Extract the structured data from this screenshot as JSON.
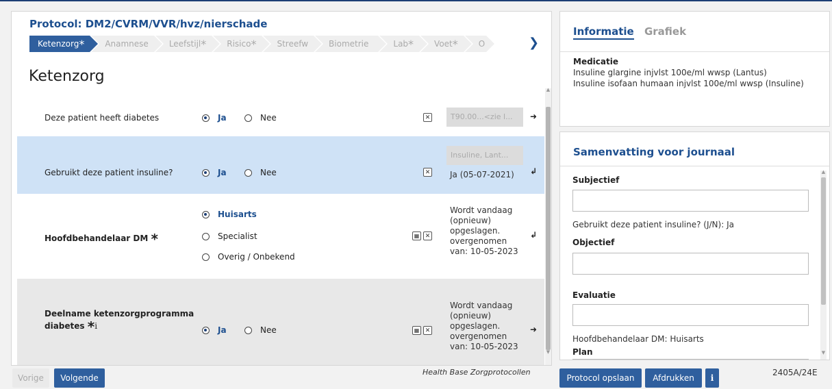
{
  "protocol_title": "Protocol: DM2/CVRM/VVR/hvz/nierschade",
  "breadcrumbs": [
    {
      "label": "Ketenzorg",
      "star": true,
      "active": true
    },
    {
      "label": "Anamnese",
      "star": false,
      "active": false
    },
    {
      "label": "Leefstijl",
      "star": true,
      "active": false
    },
    {
      "label": "Risico",
      "star": true,
      "active": false
    },
    {
      "label": "Streefw",
      "star": false,
      "active": false
    },
    {
      "label": "Biometrie",
      "star": false,
      "active": false
    },
    {
      "label": "Lab",
      "star": true,
      "active": false
    },
    {
      "label": "Voet",
      "star": true,
      "active": false
    },
    {
      "label": "O",
      "star": false,
      "active": false
    }
  ],
  "section_title": "Ketenzorg",
  "rows": [
    {
      "question": "Deze patient heeft diabetes",
      "options": [
        {
          "label": "Ja",
          "selected": true
        },
        {
          "label": "Nee",
          "selected": false
        }
      ],
      "code_placeholder": "T90.00...<zie l...",
      "note": ""
    },
    {
      "question": "Gebruikt deze patient insuline?",
      "options": [
        {
          "label": "Ja",
          "selected": true
        },
        {
          "label": "Nee",
          "selected": false
        }
      ],
      "code_placeholder": "Insuline, Lant...",
      "note": "Ja (05-07-2021)"
    },
    {
      "question": "Hoofdbehandelaar DM",
      "required": "*",
      "options": [
        {
          "label": "Huisarts",
          "selected": true
        },
        {
          "label": "Specialist",
          "selected": false
        },
        {
          "label": "Overig / Onbekend",
          "selected": false
        }
      ],
      "note_lines": [
        "Wordt vandaag",
        "(opnieuw)",
        "opgeslagen.",
        "overgenomen",
        "van: 10-05-2023"
      ]
    },
    {
      "question_line1": "Deelname ketenzorgprogramma",
      "question_line2": "diabetes",
      "required": "*",
      "info": "i",
      "options": [
        {
          "label": "Ja",
          "selected": true
        },
        {
          "label": "Nee",
          "selected": false
        }
      ],
      "note_lines": [
        "Wordt vandaag",
        "(opnieuw)",
        "opgeslagen.",
        "overgenomen",
        "van: 10-05-2023"
      ]
    }
  ],
  "nav": {
    "prev": "Vorige",
    "next": "Volgende"
  },
  "footer_brand": "Health Base Zorgprotocollen",
  "info_panel": {
    "tab_active": "Informatie",
    "tab_other": "Grafiek",
    "medication_heading": "Medicatie",
    "medication": [
      "Insuline glargine injvlst 100e/ml wwsp (Lantus)",
      "Insuline isofaan humaan injvlst 100e/ml wwsp (Insuline)"
    ]
  },
  "summary": {
    "title": "Samenvatting voor journaal",
    "subjectief_label": "Subjectief",
    "subjectief_text": "Gebruikt deze patient insuline? (J/N): Ja",
    "objectief_label": "Objectief",
    "evaluatie_label": "Evaluatie",
    "evaluatie_text": "Hoofdbehandelaar DM: Huisarts",
    "plan_label": "Plan"
  },
  "actions": {
    "save": "Protocol opslaan",
    "print": "Afdrukken",
    "info": "i"
  },
  "version": "2405A/24E"
}
